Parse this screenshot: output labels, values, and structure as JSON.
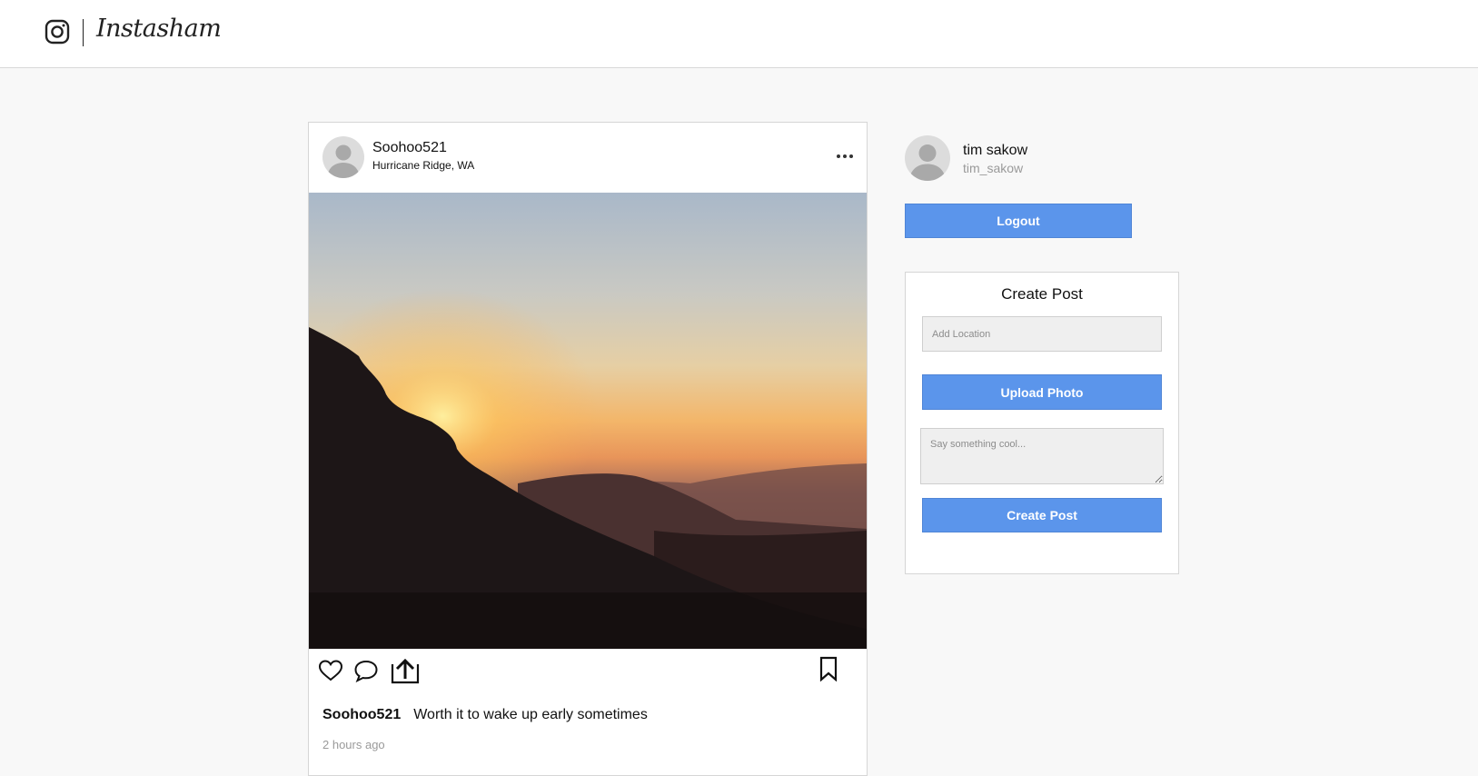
{
  "header": {
    "brand": "Instasham",
    "logo_icon": "instagram-camera-icon"
  },
  "post": {
    "username": "Soohoo521",
    "location": "Hurricane Ridge, WA",
    "photo_alt": "Sunset over mountains",
    "caption_user": "Soohoo521",
    "caption_text": "Worth it to wake up early sometimes",
    "timestamp": "2 hours ago",
    "icons": [
      "heart-icon",
      "comment-icon",
      "share-icon",
      "bookmark-icon",
      "more-icon"
    ]
  },
  "sidebar": {
    "name": "tim sakow",
    "handle": "tim_sakow",
    "logout_label": "Logout"
  },
  "create_post": {
    "title": "Create Post",
    "location_placeholder": "Add Location",
    "upload_label": "Upload Photo",
    "caption_placeholder": "Say something cool...",
    "submit_label": "Create Post"
  },
  "colors": {
    "accent": "#5b95eb",
    "background": "#f8f8f8"
  }
}
